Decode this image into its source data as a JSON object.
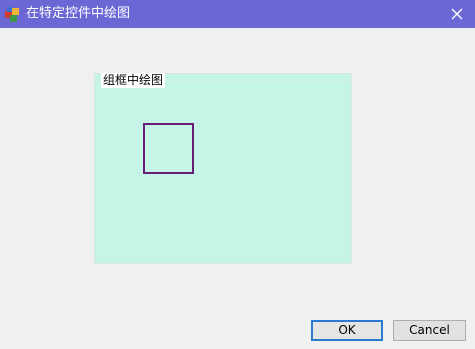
{
  "window": {
    "title": "在特定控件中绘图",
    "title_bar_color": "#6b68d6"
  },
  "icons": {
    "app": "app-icon",
    "close": "close-icon"
  },
  "groupbox": {
    "label": "组框中绘图",
    "background_color": "#c4f5e7",
    "drawn_shape": "square",
    "drawn_shape_color": "#6a1d78"
  },
  "buttons": {
    "ok_label": "OK",
    "cancel_label": "Cancel"
  }
}
